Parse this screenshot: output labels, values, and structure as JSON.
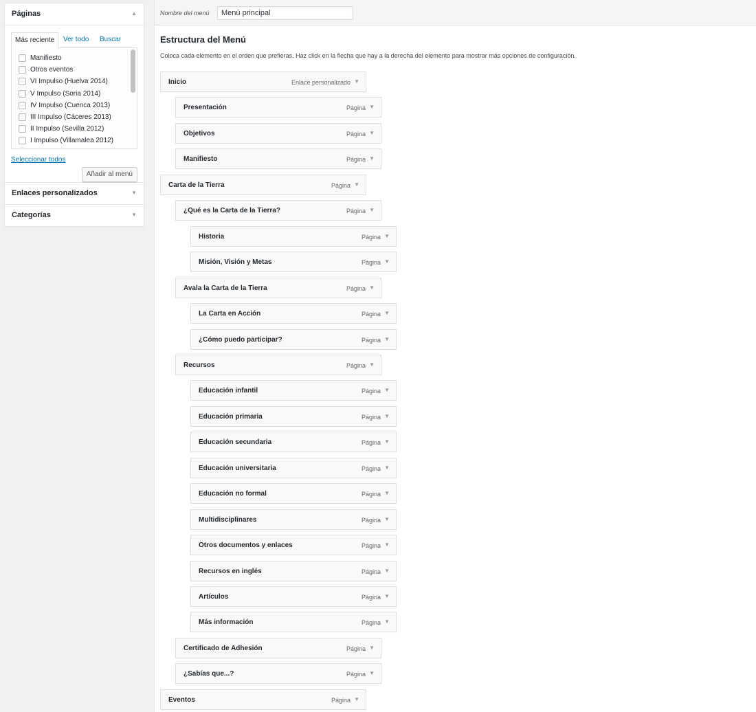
{
  "sidebar": {
    "pages": {
      "title": "Páginas",
      "tabs": [
        "Más reciente",
        "Ver todo",
        "Buscar"
      ],
      "items": [
        "Manifiesto",
        "Otros eventos",
        "VI Impulso (Huelva 2014)",
        "V Impulso (Soria 2014)",
        "IV Impulso (Cuenca 2013)",
        "III Impulso (Cáceres 2013)",
        "II Impulso (Sevilla 2012)",
        "I Impulso (Villamalea 2012)"
      ],
      "select_all": "Seleccionar todos",
      "add_button": "Añadir al menú"
    },
    "custom_links": {
      "title": "Enlaces personalizados"
    },
    "categories": {
      "title": "Categorías"
    }
  },
  "menu": {
    "name_label": "Nombre del menú",
    "name_value": "Menú principal",
    "structure_title": "Estructura del Menú",
    "structure_desc": "Coloca cada elemento en el orden que prefieras. Haz click en la flecha que hay a la derecha del elemento para mostrar más opciones de configuración.",
    "items": [
      {
        "title": "Inicio",
        "type": "Enlace personalizado",
        "depth": 0
      },
      {
        "title": "Presentación",
        "type": "Página",
        "depth": 1
      },
      {
        "title": "Objetivos",
        "type": "Página",
        "depth": 1
      },
      {
        "title": "Manifiesto",
        "type": "Página",
        "depth": 1
      },
      {
        "title": "Carta de la Tierra",
        "type": "Página",
        "depth": 0
      },
      {
        "title": "¿Qué es la Carta de la Tierra?",
        "type": "Página",
        "depth": 1
      },
      {
        "title": "Historia",
        "type": "Página",
        "depth": 2
      },
      {
        "title": "Misión, Visión y Metas",
        "type": "Página",
        "depth": 2
      },
      {
        "title": "Avala la Carta de la Tierra",
        "type": "Página",
        "depth": 1
      },
      {
        "title": "La Carta en Acción",
        "type": "Página",
        "depth": 2
      },
      {
        "title": "¿Cómo puedo participar?",
        "type": "Página",
        "depth": 2
      },
      {
        "title": "Recursos",
        "type": "Página",
        "depth": 1
      },
      {
        "title": "Educación infantil",
        "type": "Página",
        "depth": 2
      },
      {
        "title": "Educación primaria",
        "type": "Página",
        "depth": 2
      },
      {
        "title": "Educación secundaria",
        "type": "Página",
        "depth": 2
      },
      {
        "title": "Educación universitaria",
        "type": "Página",
        "depth": 2
      },
      {
        "title": "Educación no formal",
        "type": "Página",
        "depth": 2
      },
      {
        "title": "Multidisciplinares",
        "type": "Página",
        "depth": 2
      },
      {
        "title": "Otros documentos y enlaces",
        "type": "Página",
        "depth": 2
      },
      {
        "title": "Recursos en inglés",
        "type": "Página",
        "depth": 2
      },
      {
        "title": "Artículos",
        "type": "Página",
        "depth": 2
      },
      {
        "title": "Más información",
        "type": "Página",
        "depth": 2
      },
      {
        "title": "Certificado de Adhesión",
        "type": "Página",
        "depth": 1
      },
      {
        "title": "¿Sabías que...?",
        "type": "Página",
        "depth": 1
      },
      {
        "title": "Eventos",
        "type": "Página",
        "depth": 0
      }
    ]
  }
}
